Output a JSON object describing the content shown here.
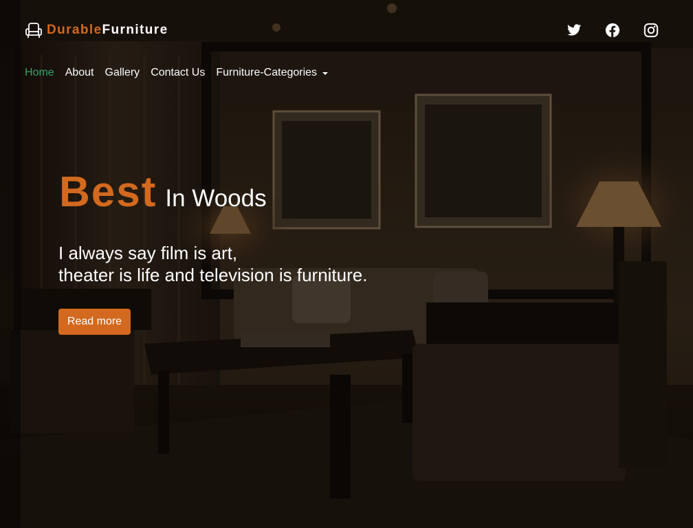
{
  "brand": {
    "logo_icon": "armchair-icon",
    "name_part1": "Durable",
    "name_part2": "Furniture"
  },
  "colors": {
    "accent": "#d2691e",
    "nav_active": "#37a36a",
    "text": "#ffffff"
  },
  "socials": [
    {
      "icon": "twitter-icon"
    },
    {
      "icon": "facebook-icon"
    },
    {
      "icon": "instagram-icon"
    }
  ],
  "nav": {
    "items": [
      {
        "label": "Home",
        "active": true
      },
      {
        "label": "About"
      },
      {
        "label": "Gallery"
      },
      {
        "label": "Contact Us"
      }
    ],
    "dropdown_label": "Furniture-Categories"
  },
  "hero": {
    "headline_big": "Best",
    "headline_small": "In Woods",
    "quote_line1": "I always say film is art,",
    "quote_line2": "theater is life and television is furniture.",
    "button_label": "Read more"
  }
}
